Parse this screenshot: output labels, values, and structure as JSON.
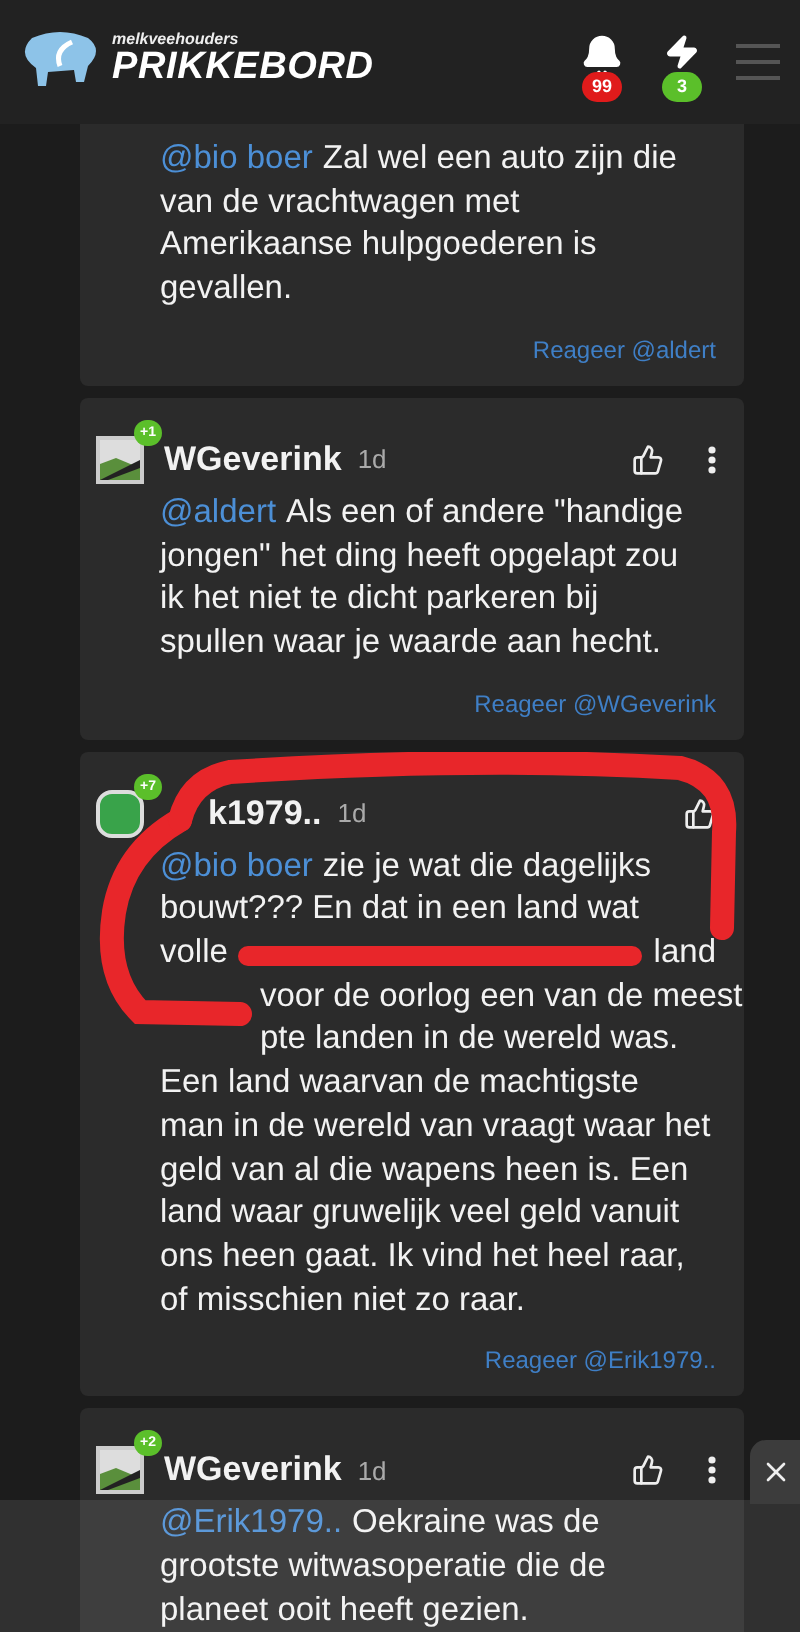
{
  "header": {
    "tagline": "melkveehouders",
    "title": "PRIKKEBORD",
    "notifications": [
      {
        "kind": "bell",
        "count": "99",
        "color": "#e01b1b"
      },
      {
        "kind": "bolt",
        "count": "3",
        "color": "#5bbf2a"
      }
    ]
  },
  "comments": [
    {
      "mention": "@bio boer",
      "lines": [
        {
          "parts": [
            "Zal wel een auto zijn die"
          ]
        },
        {
          "parts": [
            "van de vrachtwagen met"
          ]
        },
        {
          "parts": [
            "Amerikaanse hulpgoederen is"
          ]
        },
        {
          "parts": [
            "gevallen."
          ]
        }
      ],
      "reply": "Reageer @aldert"
    },
    {
      "header": {
        "name": "WGeverink",
        "age": "1d",
        "score": "+1",
        "kind": "image",
        "menu": true
      },
      "mention": "@aldert",
      "lines": [
        {
          "parts": [
            "Als een of andere \"handige"
          ]
        },
        {
          "parts": [
            "jongen\" het ding heeft opgelapt zou"
          ]
        },
        {
          "parts": [
            "ik het niet te dicht parkeren bij"
          ]
        },
        {
          "parts": [
            "spullen waar je waarde aan hecht."
          ]
        }
      ],
      "reply": "Reageer @WGeverink"
    },
    {
      "header": {
        "name": "k1979..",
        "name_start_hidden": true,
        "age": "1d",
        "score": "+7",
        "kind": "green",
        "menu": false
      },
      "mention": "@bio boer",
      "lines": [
        {
          "parts": [
            "zie je wat die dagelijks"
          ]
        },
        {
          "parts": [
            "bouwt??? En dat in een land wat"
          ]
        },
        {
          "parts": [
            "volle",
            "land"
          ]
        },
        {
          "parts": [
            "voor de oorlog een van de meest"
          ],
          "start_hidden": true
        },
        {
          "parts": [
            "pte landen in de wereld was."
          ],
          "start_hidden": true
        },
        {
          "parts": [
            "Een land waarvan de machtigste"
          ]
        },
        {
          "parts": [
            "man in de wereld van vraagt waar het"
          ]
        },
        {
          "parts": [
            "geld van al die wapens heen is. Een"
          ]
        },
        {
          "parts": [
            "land waar gruwelijk veel geld vanuit"
          ]
        },
        {
          "parts": [
            "ons heen gaat. Ik vind het heel raar,"
          ]
        },
        {
          "parts": [
            "of misschien niet zo raar."
          ]
        }
      ],
      "reply": "Reageer @Erik1979.."
    },
    {
      "header": {
        "name": "WGeverink",
        "age": "1d",
        "score": "+2",
        "kind": "image",
        "menu": true
      },
      "mention": "@Erik1979..",
      "lines": [
        {
          "parts": [
            "Oekraine was de"
          ]
        },
        {
          "parts": [
            "grootste witwasoperatie die de"
          ]
        },
        {
          "parts": [
            "planeet ooit heeft gezien."
          ]
        }
      ]
    }
  ],
  "overlay": {
    "shown": true
  }
}
